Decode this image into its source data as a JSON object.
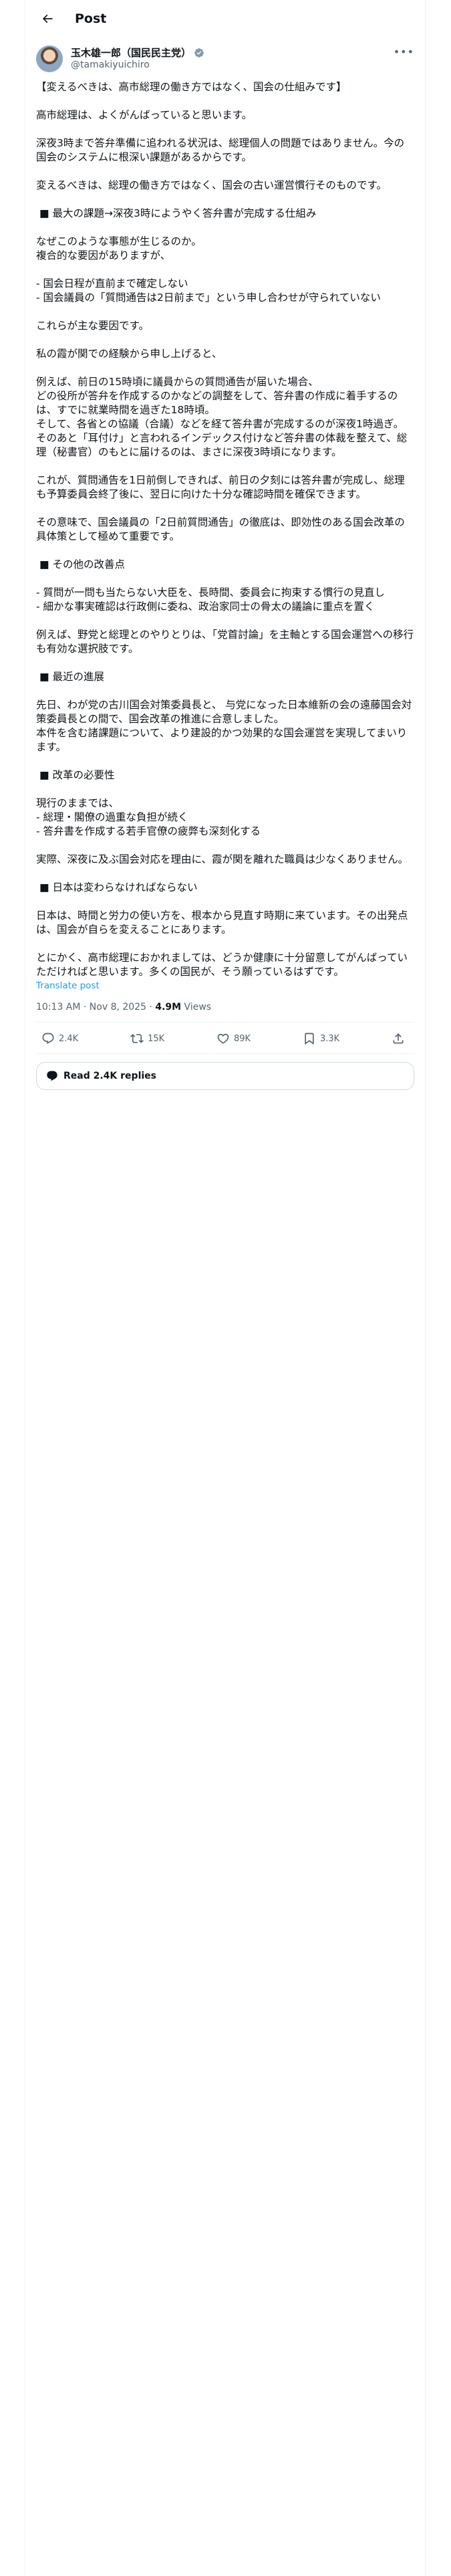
{
  "header": {
    "title": "Post"
  },
  "author": {
    "display_name": "玉木雄一郎（国民民主党）",
    "handle": "@tamakiyuichiro"
  },
  "post": {
    "text": "【変えるべきは、高市総理の働き方ではなく、国会の仕組みです】\n\n高市総理は、よくがんばっていると思います。\n\n深夜3時まで答弁準備に追われる状況は、総理個人の問題ではありません。今の国会のシステムに根深い課題があるからです。\n\n変えるべきは、総理の働き方ではなく、国会の古い運営慣行そのものです。\n\n ■ 最大の課題→深夜3時にようやく答弁書が完成する仕組み\n\nなぜこのような事態が生じるのか。\n複合的な要因がありますが、\n\n- 国会日程が直前まで確定しない\n- 国会議員の「質問通告は2日前まで」という申し合わせが守られていない\n\nこれらが主な要因です。\n\n私の霞が関での経験から申し上げると、\n\n例えば、前日の15時頃に議員からの質問通告が届いた場合、\nどの役所が答弁を作成するのかなどの調整をして、答弁書の作成に着手するのは、すでに就業時間を過ぎた18時頃。\nそして、各省との協議（合議）などを経て答弁書が完成するのが深夜1時過ぎ。\nそのあと「耳付け」と言われるインデックス付けなど答弁書の体裁を整えて、総理（秘書官）のもとに届けるのは、まさに深夜3時頃になります。\n\nこれが、質問通告を1日前倒しできれば、前日の夕刻には答弁書が完成し、総理も予算委員会終了後に、翌日に向けた十分な確認時間を確保できます。\n\nその意味で、国会議員の「2日前質問通告」の徹底は、即効性のある国会改革の具体策として極めて重要です。\n\n ■ その他の改善点\n\n- 質問が一問も当たらない大臣を、長時間、委員会に拘束する慣行の見直し\n- 細かな事実確認は行政側に委ね、政治家同士の骨太の議論に重点を置く\n\n例えば、野党と総理とのやりとりは、「党首討論」を主軸とする国会運営への移行も有効な選択肢です。\n\n ■ 最近の進展\n\n先日、わが党の古川国会対策委員長と、 与党になった日本維新の会の遠藤国会対策委員長との間で、国会改革の推進に合意しました。\n本件を含む諸課題について、より建設的かつ効果的な国会運営を実現してまいります。\n\n ■ 改革の必要性\n\n現行のままでは、\n- 総理・閣僚の過重な負担が続く\n- 答弁書を作成する若手官僚の疲弊も深刻化する\n\n実際、深夜に及ぶ国会対応を理由に、霞が関を離れた職員は少なくありません。\n\n ■ 日本は変わらなければならない\n\n日本は、時間と労力の使い方を、根本から見直す時期に来ています。その出発点は、国会が自らを変えることにあります。\n\nとにかく、高市総理におかれましては、どうか健康に十分留意してがんばっていただければと思います。多くの国民が、そう願っているはずです。",
    "translate_label": "Translate post",
    "time": "10:13 AM · Nov 8, 2025 · ",
    "views_count": "4.9M",
    "views_label": " Views"
  },
  "actions": {
    "replies": "2.4K",
    "reposts": "15K",
    "likes": "89K",
    "bookmarks": "3.3K"
  },
  "read_replies_label": "Read 2.4K replies",
  "icons": {
    "back": "back-arrow-icon",
    "verified": "verified-badge-icon",
    "more": "more-icon",
    "reply": "reply-icon",
    "repost": "repost-icon",
    "like": "heart-icon",
    "bookmark": "bookmark-icon",
    "share": "share-icon"
  },
  "colors": {
    "link": "#1d9bf0",
    "secondary_text": "#536471",
    "border": "#eff3f4",
    "verified": "#829aab"
  }
}
